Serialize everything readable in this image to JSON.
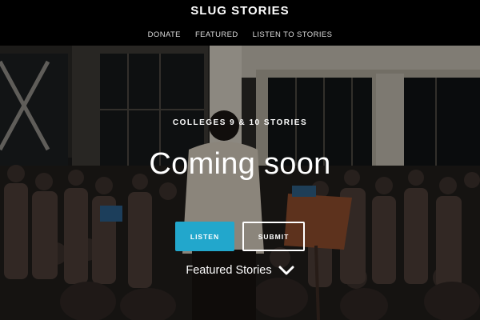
{
  "header": {
    "title": "SLUG STORIES",
    "nav": [
      {
        "label": "DONATE"
      },
      {
        "label": "FEATURED"
      },
      {
        "label": "LISTEN TO STORIES"
      }
    ]
  },
  "hero": {
    "eyebrow": "COLLEGES 9 & 10 STORIES",
    "headline": "Coming soon",
    "buttons": {
      "listen_label": "LISTEN",
      "submit_label": "SUBMIT"
    },
    "featured_label": "Featured Stories"
  },
  "colors": {
    "header_bg": "#000000",
    "accent": "#22a7cc",
    "text": "#ffffff"
  },
  "icons": {
    "featured_toggle": "chevron-down-icon"
  }
}
